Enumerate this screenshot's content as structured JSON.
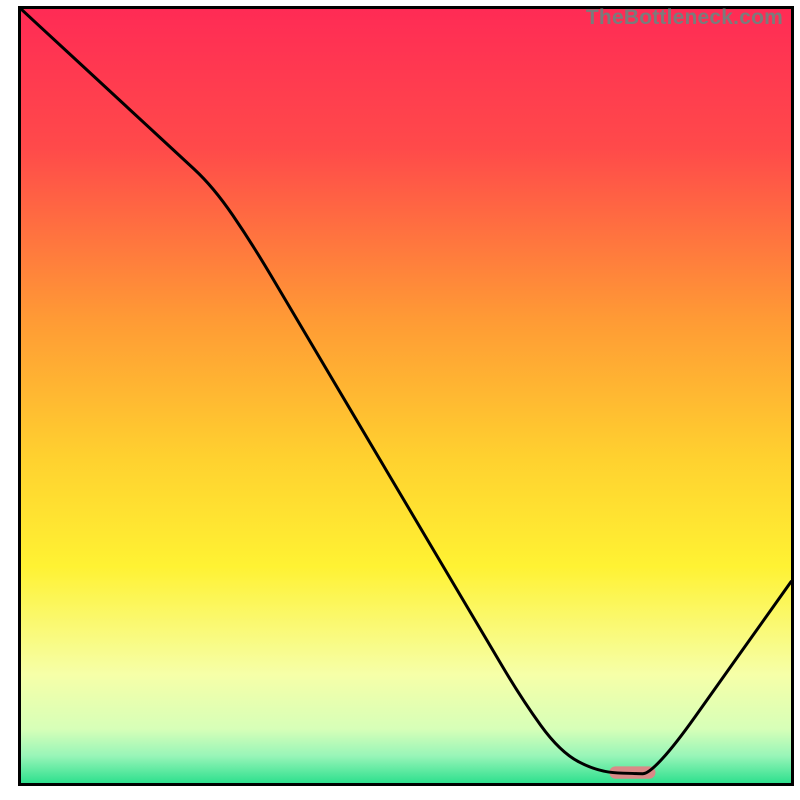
{
  "watermark": "TheBottleneck.com",
  "chart_data": {
    "type": "line",
    "title": "",
    "xlabel": "",
    "ylabel": "",
    "xlim": [
      0,
      100
    ],
    "ylim": [
      0,
      100
    ],
    "grid": false,
    "legend": false,
    "series": [
      {
        "name": "curve",
        "x": [
          0,
          5,
          10,
          15,
          20,
          25,
          30,
          35,
          40,
          45,
          50,
          55,
          60,
          65,
          70,
          75,
          80,
          81.5,
          85,
          90,
          95,
          100
        ],
        "y": [
          100,
          95.4,
          90.8,
          86.2,
          81.6,
          77.0,
          69.7,
          61.3,
          52.9,
          44.5,
          36.1,
          27.7,
          19.3,
          10.9,
          4.0,
          1.4,
          1.2,
          1.2,
          5.0,
          12.0,
          19.0,
          26.0
        ]
      }
    ],
    "annotations": [
      {
        "name": "marker",
        "shape": "rounded-bar",
        "x_center": 79.4,
        "y_center": 1.35,
        "width_x": 6.0,
        "height_y": 1.6,
        "fill": "#d98a87"
      }
    ],
    "gradient_stops": [
      {
        "pos": 0.0,
        "color": "#ff2b55"
      },
      {
        "pos": 0.18,
        "color": "#ff4a4a"
      },
      {
        "pos": 0.4,
        "color": "#ff9a35"
      },
      {
        "pos": 0.58,
        "color": "#ffd12f"
      },
      {
        "pos": 0.72,
        "color": "#fff233"
      },
      {
        "pos": 0.86,
        "color": "#f6ffa8"
      },
      {
        "pos": 0.93,
        "color": "#d7ffb8"
      },
      {
        "pos": 0.965,
        "color": "#98f5b8"
      },
      {
        "pos": 1.0,
        "color": "#2ee08e"
      }
    ]
  }
}
